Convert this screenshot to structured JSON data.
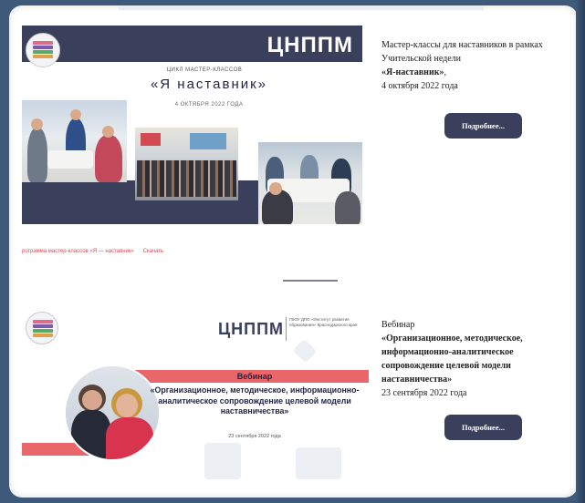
{
  "card1": {
    "banner": {
      "brand": "ЦНППМ",
      "subtitle": "ЦИКЛ МАСТЕР-КЛАССОВ",
      "title": "«Я   наставник»",
      "date": "4 ОКТЯБРЯ 2022 ГОДА"
    },
    "text_line1": "Мастер-классы для наставников в рамках Учительской недели",
    "text_bold": "«Я-наставник»",
    "text_comma": ",",
    "text_date": "4 октября 2022 года",
    "button_label": "Подробнее...",
    "link_program": "рограмма мастер-классов «Я — наставник»",
    "link_download": "Скачать"
  },
  "card2": {
    "banner": {
      "brand": "ЦНППМ",
      "note": "ГБОУ ДПО «Институт развития образования» Краснодарского края",
      "webinar_label": "Вебинар",
      "webinar_title": "«Организационное, методическое, информационно-аналитическое сопровождение целевой модели наставничества»",
      "webinar_date": "23 сентября 2022 года"
    },
    "label": "Вебинар",
    "title": "«Организационное, методическое, информационно-аналитическое сопровождение целевой модели наставничества»",
    "date": "23 сентября 2022 года",
    "button_label": "Подробнее..."
  },
  "colors": {
    "navy": "#3a3f5c",
    "accent_red": "#e9666b",
    "link_red": "#d24b52",
    "background": "#3e5a7a"
  }
}
